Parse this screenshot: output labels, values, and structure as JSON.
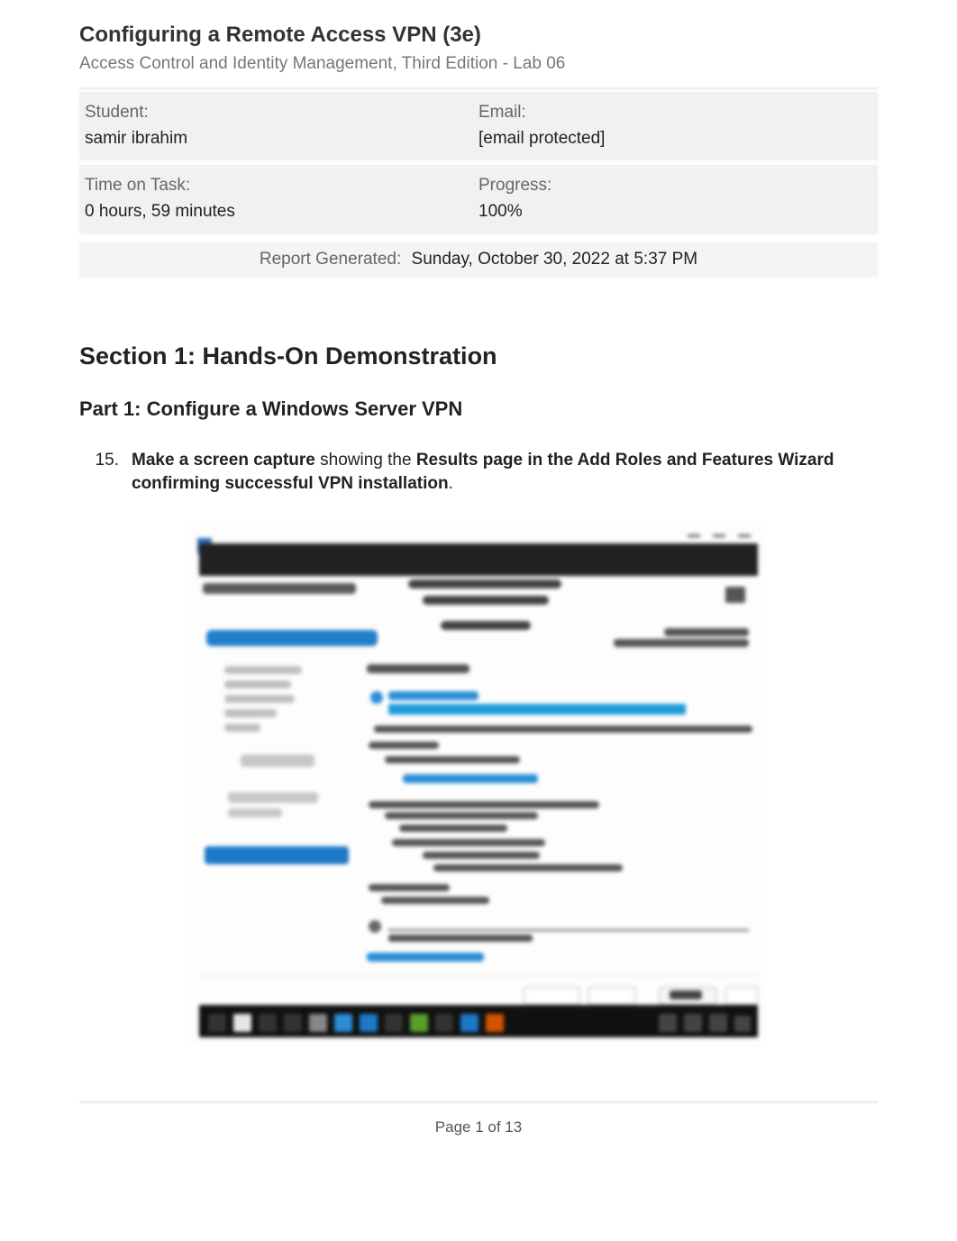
{
  "header": {
    "title": "Configuring a Remote Access VPN (3e)",
    "subtitle": "Access Control and Identity Management, Third Edition - Lab 06"
  },
  "student_block": {
    "student_label": "Student:",
    "student_value": "samir ibrahim",
    "email_label": "Email:",
    "email_value": "[email protected]"
  },
  "time_block": {
    "time_label": "Time on Task:",
    "time_value": "0 hours, 59 minutes",
    "progress_label": "Progress:",
    "progress_value": "100%"
  },
  "report": {
    "label": "Report Generated:",
    "value": "Sunday, October 30, 2022 at 5:37 PM"
  },
  "section": {
    "heading": "Section 1: Hands-On Demonstration",
    "part": "Part 1: Configure a Windows Server VPN"
  },
  "step": {
    "number": "15.",
    "bold1": "Make a screen capture",
    "middle": " showing the ",
    "bold2": "Results page in the Add Roles and Features Wizard confirming successful VPN installation",
    "end": "."
  },
  "footer": {
    "page": "Page 1 of 13"
  }
}
